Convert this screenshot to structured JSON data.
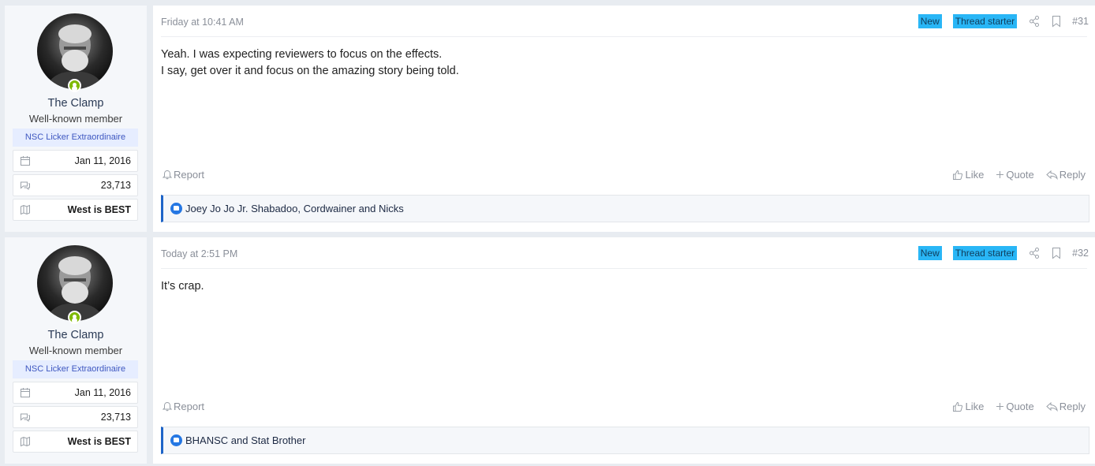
{
  "posts": [
    {
      "user": {
        "name": "The Clamp",
        "title": "Well-known member",
        "banner": "NSC Licker Extraordinaire",
        "joined": "Jan 11, 2016",
        "messages": "23,713",
        "location": "West is BEST"
      },
      "date": "Friday at 10:41 AM",
      "badges": {
        "new": "New",
        "starter": "Thread starter"
      },
      "number": "#31",
      "lines": [
        "Yeah. I was expecting reviewers to focus on the effects.",
        "I say, get over it and focus on the amazing story being told."
      ],
      "actions": {
        "report": "Report",
        "like": "Like",
        "quote": "Quote",
        "reply": "Reply"
      },
      "reactions": "Joey Jo Jo Jr. Shabadoo, Cordwainer and Nicks"
    },
    {
      "user": {
        "name": "The Clamp",
        "title": "Well-known member",
        "banner": "NSC Licker Extraordinaire",
        "joined": "Jan 11, 2016",
        "messages": "23,713",
        "location": "West is BEST"
      },
      "date": "Today at 2:51 PM",
      "badges": {
        "new": "New",
        "starter": "Thread starter"
      },
      "number": "#32",
      "lines": [
        "It’s crap.",
        ""
      ],
      "actions": {
        "report": "Report",
        "like": "Like",
        "quote": "Quote",
        "reply": "Reply"
      },
      "reactions": "BHANSC and Stat Brother"
    }
  ],
  "colors": {
    "accent": "#1e64c8",
    "badge": "#29b6f6",
    "online": "#7fb900"
  },
  "icons": [
    "calendar-icon",
    "messages-icon",
    "map-icon",
    "share-icon",
    "bookmark-icon",
    "bell-icon",
    "thumbs-up-icon",
    "plus-icon",
    "reply-icon",
    "like-reaction-icon",
    "online-status-icon"
  ]
}
